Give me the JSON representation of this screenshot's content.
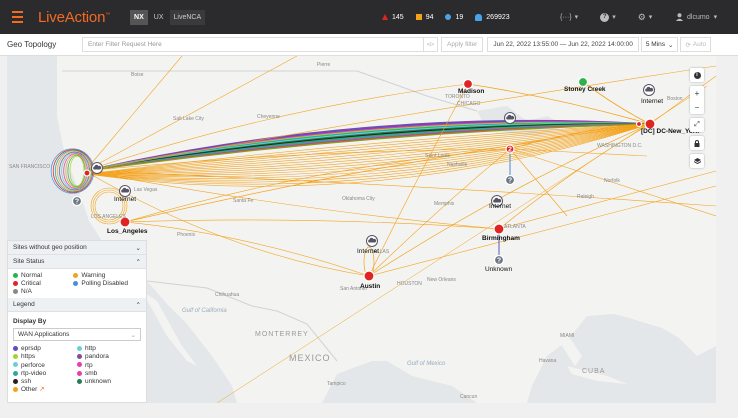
{
  "app": {
    "logo": "LiveAction",
    "products": [
      "NX",
      "UX",
      "LiveNCA"
    ],
    "active_product": "NX"
  },
  "alerts": {
    "critical": "145",
    "warning": "94",
    "info": "19",
    "notifications": "269923"
  },
  "topbar": {
    "code_menu": "{···}",
    "help_menu": "?",
    "settings_menu": "⚙",
    "user": "dlcumo"
  },
  "filterbar": {
    "title": "Geo Topology",
    "filter_placeholder": "Enter Filter Request Here",
    "code_label": "</>",
    "apply_label": "Apply filter",
    "date_range": "Jun 22, 2022 13:55:00 — Jun 22, 2022 14:00:00",
    "interval": "5 Mins",
    "auto_label": "Auto"
  },
  "panel": {
    "sites_without_geo": "Sites without geo position",
    "site_status_title": "Site Status",
    "statuses": [
      {
        "label": "Normal",
        "color": "#2bb24c"
      },
      {
        "label": "Warning",
        "color": "#f4a21c"
      },
      {
        "label": "Critical",
        "color": "#e02424"
      },
      {
        "label": "Polling Disabled",
        "color": "#4a90d9"
      },
      {
        "label": "N/A",
        "color": "#888888"
      }
    ],
    "legend_title": "Legend",
    "display_by_label": "Display By",
    "display_by_value": "WAN Applications",
    "legend_items": [
      {
        "label": "eprsdp",
        "color": "#5b4bd1"
      },
      {
        "label": "http",
        "color": "#6ad1d1"
      },
      {
        "label": "https",
        "color": "#a4d233"
      },
      {
        "label": "pandora",
        "color": "#7b4f9c"
      },
      {
        "label": "perforce",
        "color": "#6ad1d1"
      },
      {
        "label": "rtp",
        "color": "#e83dad"
      },
      {
        "label": "rtp-video",
        "color": "#2aa8a8"
      },
      {
        "label": "smb",
        "color": "#e83dad"
      },
      {
        "label": "ssh",
        "color": "#222222"
      },
      {
        "label": "unknown",
        "color": "#2a7a55"
      },
      {
        "label": "Other",
        "color": "#f4a21c"
      }
    ]
  },
  "map": {
    "nodes": {
      "dc_new_york": "[DC] DC-New_York",
      "madison": "Madison",
      "stoney_creek": "Stoney Creek",
      "internet_ne": "Internet",
      "internet_west": "Internet",
      "los_angeles": "Los_Angeles",
      "internet_south": "Internet",
      "birmingham": "Birmingham",
      "unknown": "Unknown",
      "internet_tx": "Internet",
      "austin": "Austin"
    },
    "places": {
      "toronto": "TORONTO",
      "chicago": "CHICAGO",
      "washington": "WASHINGTON D.C.",
      "boston": "Boston",
      "norfolk": "Norfolk",
      "raleigh": "Raleigh",
      "nashville": "Nashville",
      "atlanta": "ATLANTA",
      "memphis": "Memphis",
      "oklahoma": "Oklahoma City",
      "dallas": "DALLAS",
      "houston": "HOUSTON",
      "san_antonio": "San Antonio",
      "new_orleans": "New Orleans",
      "miami": "MIAMI",
      "havana": "Havana",
      "cuba": "CUBA",
      "monterrey": "MONTERREY",
      "mexico": "MEXICO",
      "chihuahua": "Chihuahua",
      "phoenix": "Phoenix",
      "las_vegas": "Las Vegas",
      "salt_lake": "Salt Lake City",
      "cheyenne": "Cheyenne",
      "boise": "Boise",
      "pierre": "Pierre",
      "santa_fe": "Santa Fe",
      "saint_louis": "Saint Louis",
      "san_francisco": "SAN FRANCISCO",
      "los_angeles_city": "LOS ANGELES",
      "gulf_california": "Gulf of California",
      "gulf_mexico": "Gulf of Mexico",
      "tampico": "Tampico",
      "cancun": "Cancun"
    },
    "controls": {
      "info": "i",
      "zoom_in": "+",
      "zoom_out": "−",
      "fit": "⤢",
      "lock": "🔒",
      "layers": "≡"
    }
  }
}
